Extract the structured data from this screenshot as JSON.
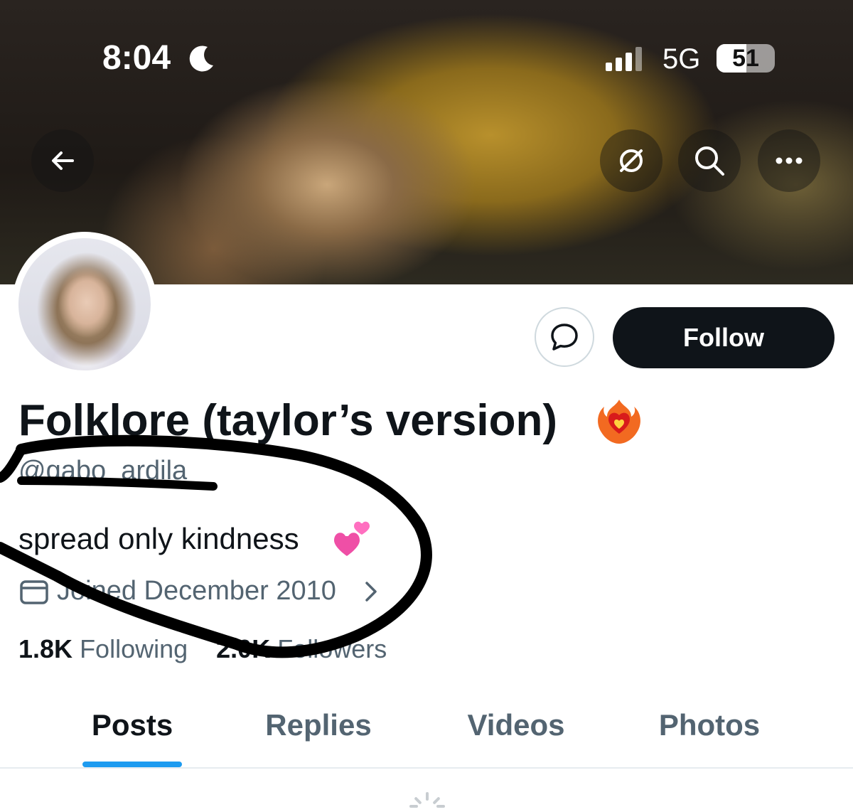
{
  "status_bar": {
    "time": "8:04",
    "network": "5G",
    "battery": "51",
    "battery_level": 0.51
  },
  "header": {
    "back_icon": "arrow-left-icon",
    "hide_icon": "eye-slash-icon",
    "search_icon": "search-icon",
    "more_icon": "ellipsis-icon"
  },
  "profile": {
    "name": "Folklore (taylor’s version)",
    "name_emoji": "heart-on-fire",
    "handle": "@gabo_ardila",
    "bio": "spread only kindness",
    "bio_emoji": "two-hearts",
    "joined": "Joined December 2010",
    "following_count": "1.8K",
    "following_label": "Following",
    "followers_count": "2.0K",
    "followers_label": "Followers",
    "follow_label": "Follow"
  },
  "tabs": [
    {
      "label": "Posts"
    },
    {
      "label": "Replies"
    },
    {
      "label": "Videos"
    },
    {
      "label": "Photos"
    }
  ],
  "colors": {
    "accent": "#1d9bf0",
    "text": "#0f1419",
    "secondary": "#536471"
  }
}
